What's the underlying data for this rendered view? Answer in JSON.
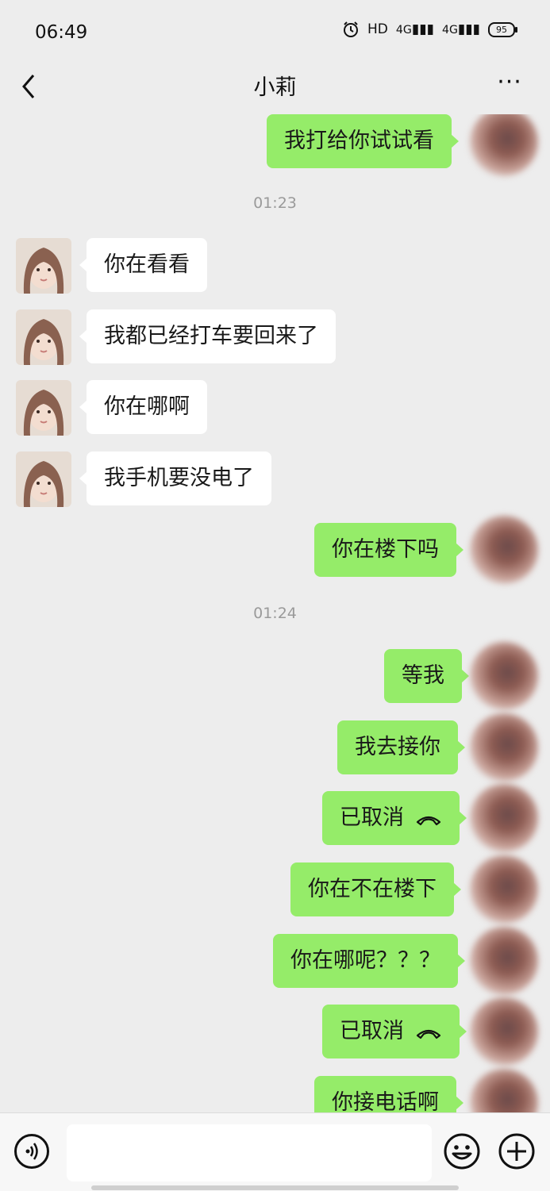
{
  "status_bar": {
    "time": "06:49",
    "hd_label": "HD",
    "signal1": "4G",
    "signal2": "4G",
    "battery": "95"
  },
  "header": {
    "title": "小莉",
    "more_label": "···"
  },
  "timestamps": [
    "01:23",
    "01:24"
  ],
  "messages": [
    {
      "side": "out",
      "text": "我打给你试试看"
    },
    {
      "side": "in",
      "text": "你在看看"
    },
    {
      "side": "in",
      "text": "我都已经打车要回来了"
    },
    {
      "side": "in",
      "text": "你在哪啊"
    },
    {
      "side": "in",
      "text": "我手机要没电了"
    },
    {
      "side": "out",
      "text": "你在楼下吗"
    },
    {
      "side": "out",
      "text": "等我"
    },
    {
      "side": "out",
      "text": "我去接你"
    },
    {
      "side": "out",
      "text": "已取消",
      "icon": "hangup-icon"
    },
    {
      "side": "out",
      "text": "你在不在楼下"
    },
    {
      "side": "out",
      "text": "你在哪呢？？？"
    },
    {
      "side": "out",
      "text": "已取消",
      "icon": "hangup-icon"
    },
    {
      "side": "out",
      "text": "你接电话啊"
    }
  ],
  "colors": {
    "outgoing_bubble": "#95ec69",
    "incoming_bubble": "#ffffff",
    "background": "#ededed"
  },
  "input_bar": {
    "placeholder": "",
    "icons": [
      "voice-icon",
      "emoji-icon",
      "plus-icon"
    ]
  }
}
